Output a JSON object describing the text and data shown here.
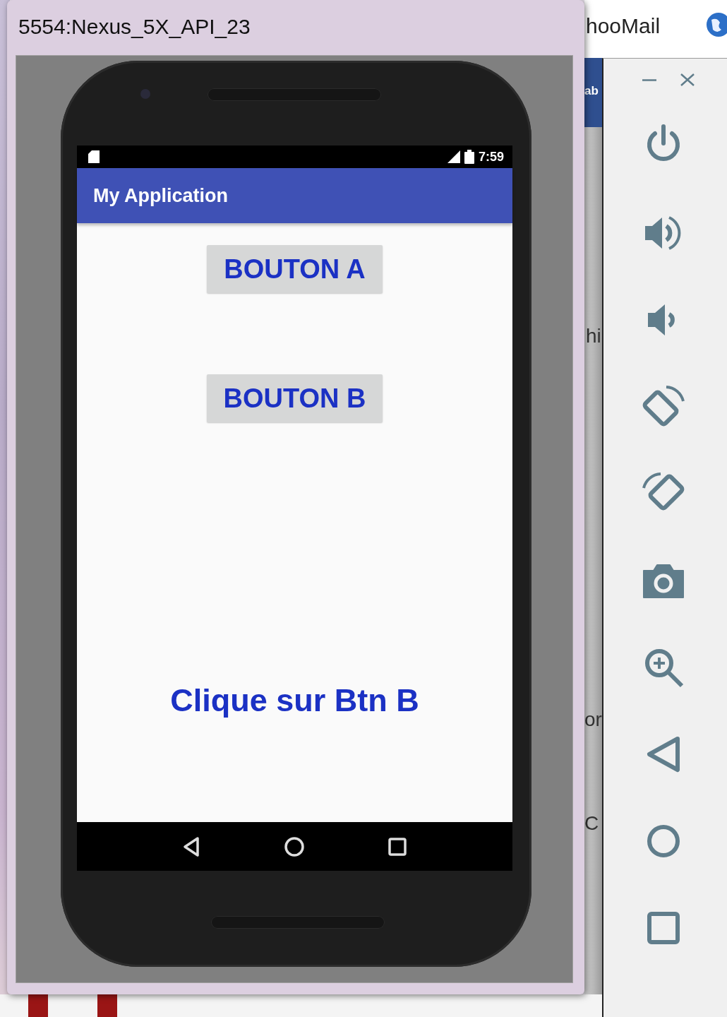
{
  "desktop": {
    "background_texts": [
      {
        "text": "hooMail"
      },
      {
        "text": "ab"
      },
      {
        "text": "hi"
      },
      {
        "text": "or"
      },
      {
        "text": "C"
      }
    ]
  },
  "emulator_window": {
    "title": "5554:Nexus_5X_API_23"
  },
  "phone": {
    "status_bar": {
      "time": "7:59"
    },
    "app_bar": {
      "title": "My Application"
    },
    "buttons": [
      {
        "label": "BOUTON A"
      },
      {
        "label": "BOUTON B"
      }
    ],
    "message": "Clique sur Btn B",
    "nav_buttons": [
      {
        "kind": "back"
      },
      {
        "kind": "home"
      },
      {
        "kind": "recents"
      }
    ]
  },
  "toolbar": {
    "window_controls": [
      {
        "kind": "minimize"
      },
      {
        "kind": "close"
      }
    ],
    "tools": [
      {
        "kind": "power"
      },
      {
        "kind": "volume-up"
      },
      {
        "kind": "volume-down"
      },
      {
        "kind": "rotate-left"
      },
      {
        "kind": "rotate-right"
      },
      {
        "kind": "screenshot"
      },
      {
        "kind": "zoom"
      },
      {
        "kind": "back"
      },
      {
        "kind": "home"
      },
      {
        "kind": "overview"
      }
    ]
  }
}
